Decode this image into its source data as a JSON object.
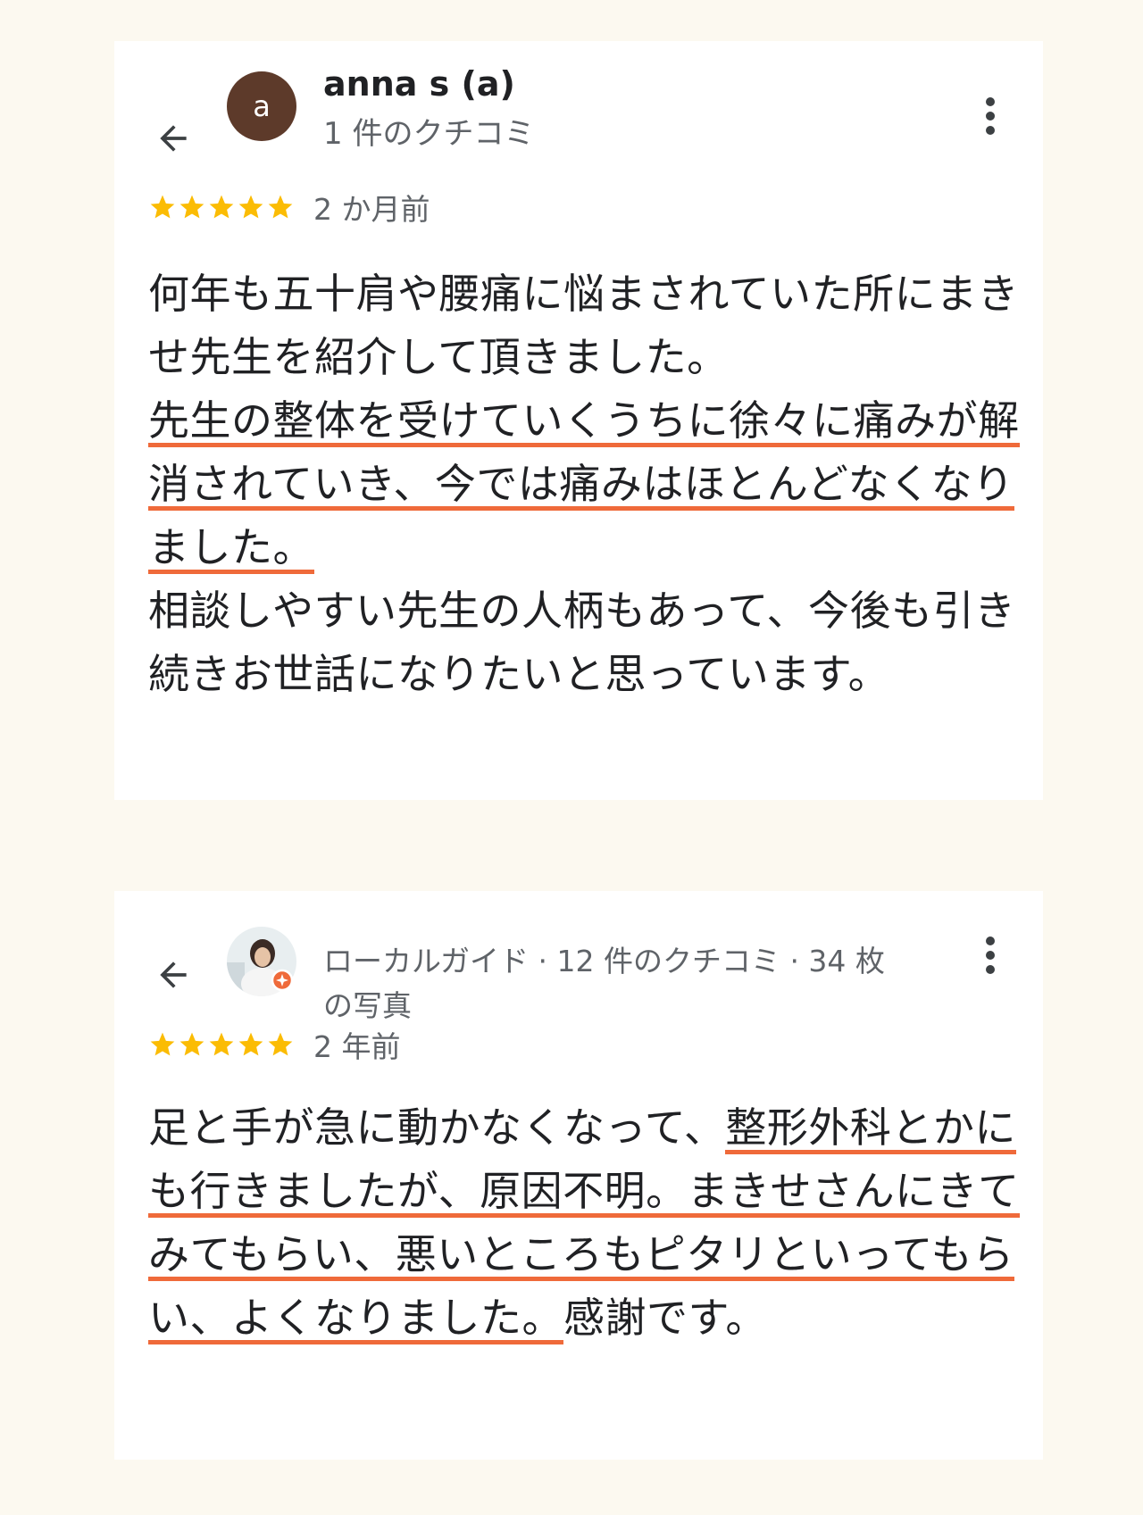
{
  "colors": {
    "page_background": "#fcf9f0",
    "card_background": "#ffffff",
    "star": "#fbbc04",
    "highlight_underline": "#ef6a3a",
    "avatar_background": "#5d3a2a",
    "local_guide_badge": "#ef6a3a"
  },
  "reviews": [
    {
      "reviewer_name": "anna s (a)",
      "avatar_letter": "a",
      "reviewer_meta": "1 件のクチコミ",
      "rating": 5,
      "time_ago": "2 か月前",
      "text_before": "何年も五十肩や腰痛に悩まされていた所にまきせ先生を紹介して頂きました。",
      "text_highlight": "先生の整体を受けていくうちに徐々に痛みが解消されていき、今では痛みはほとんどなくなりました。",
      "text_after": "相談しやすい先生の人柄もあって、今後も引き続きお世話になりたいと思っています。",
      "icons": {
        "back": "arrow-back-icon",
        "more": "more-vert-icon"
      }
    },
    {
      "reviewer_meta": "ローカルガイド · 12 件のクチコミ · 34 枚の写真",
      "rating": 5,
      "time_ago": "2 年前",
      "text_before": "足と手が急に動かなくなって、",
      "text_highlight": "整形外科とかにも行きましたが、原因不明。まきせさんにきてみてもらい、悪いところもピタリといってもらい、よくなりました。",
      "text_after": "感謝です。",
      "icons": {
        "back": "arrow-back-icon",
        "more": "more-vert-icon",
        "badge": "local-guide-badge-icon"
      }
    }
  ]
}
